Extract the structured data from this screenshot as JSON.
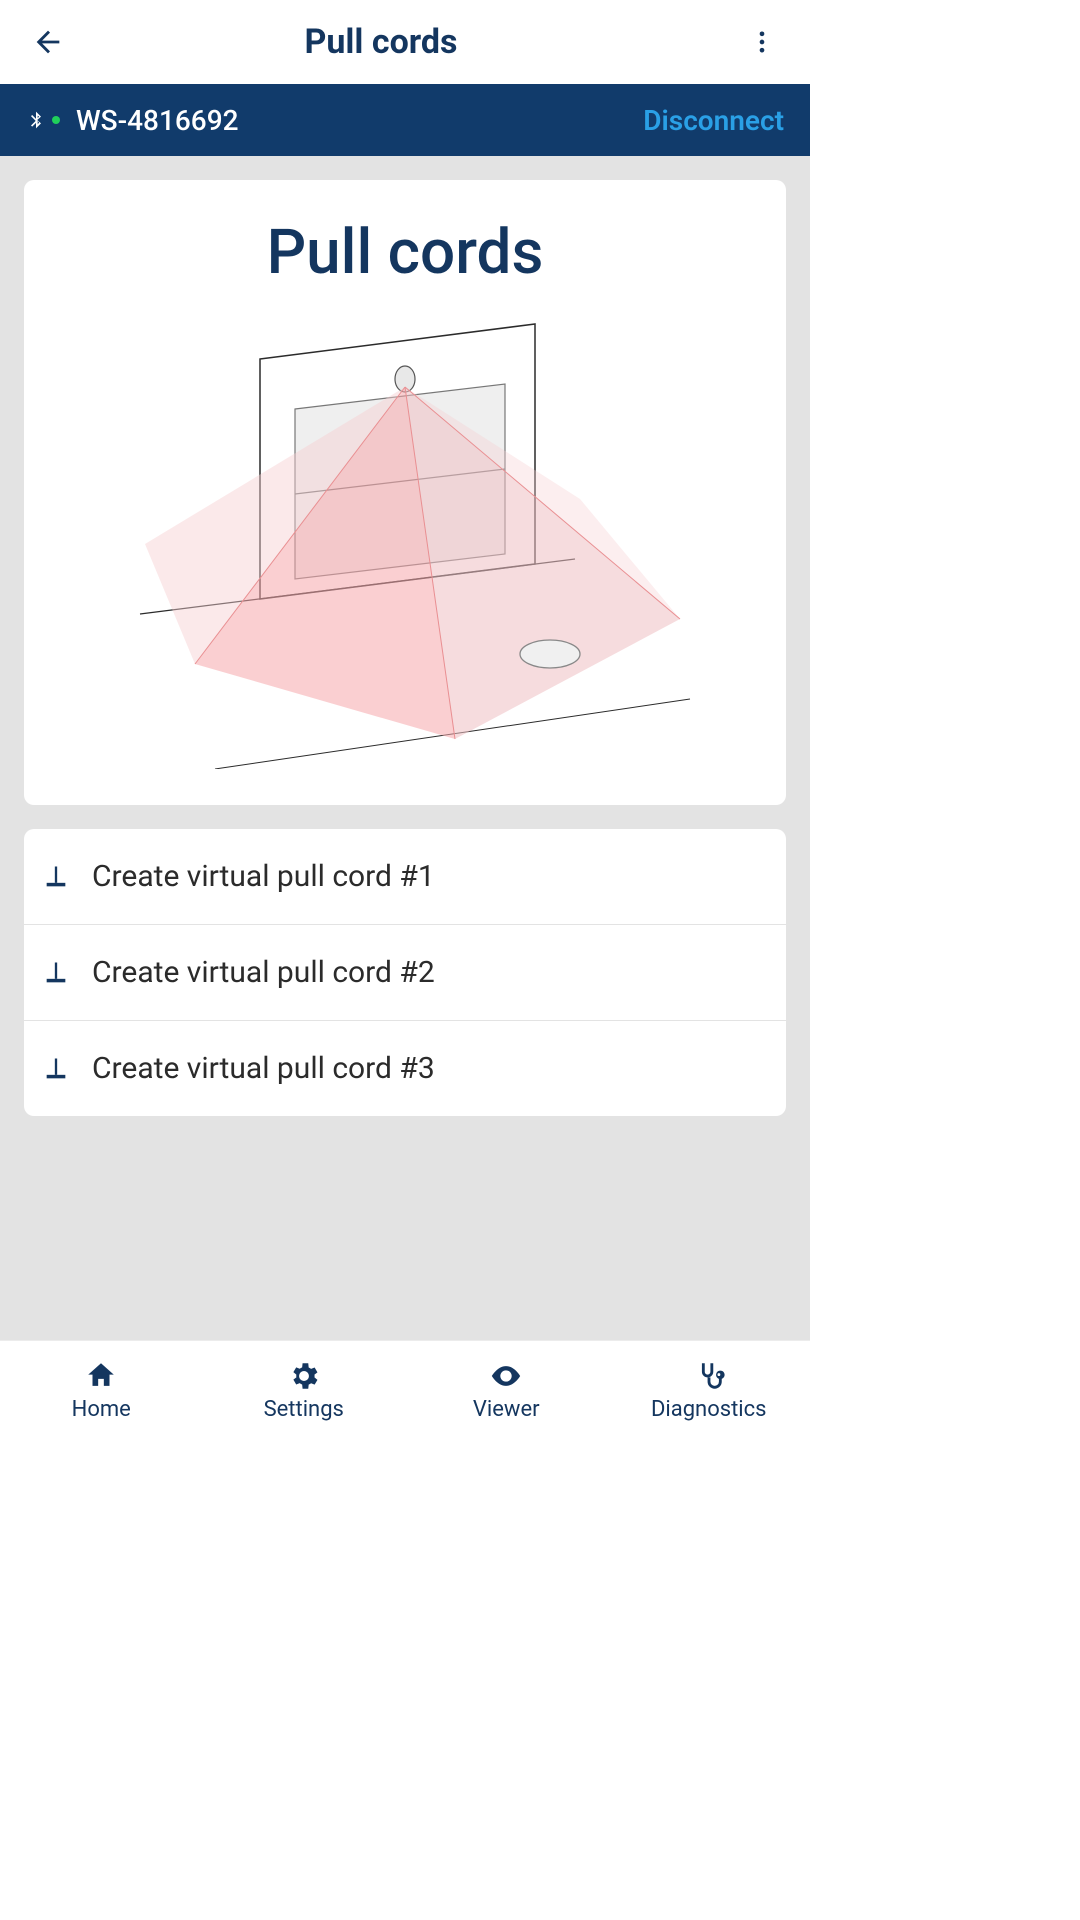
{
  "appbar": {
    "title": "Pull cords"
  },
  "device": {
    "name": "WS-4816692",
    "disconnect_label": "Disconnect"
  },
  "card": {
    "title": "Pull cords"
  },
  "rows": [
    {
      "label": "Create virtual pull cord #1"
    },
    {
      "label": "Create virtual pull cord #2"
    },
    {
      "label": "Create virtual pull cord #3"
    }
  ],
  "nav": {
    "home": "Home",
    "settings": "Settings",
    "viewer": "Viewer",
    "diagnostics": "Diagnostics"
  }
}
